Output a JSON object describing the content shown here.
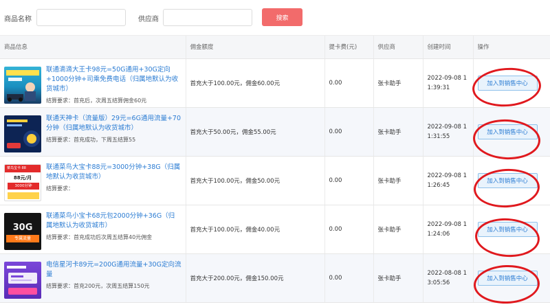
{
  "search": {
    "product_label": "商品名称",
    "product_value": "",
    "supplier_label": "供应商",
    "supplier_value": "",
    "button_label": "搜索"
  },
  "table": {
    "headers": [
      "商品信息",
      "佣金额度",
      "提卡费(元)",
      "供应商",
      "创建时间",
      "操作"
    ],
    "rows": [
      {
        "title": "联通滴滴大王卡98元=50G通用+30G定向+1000分钟+司乘免费电话（归属地默认为收货城市）",
        "settle": "结算要求：首充后，次周五结算佣金60元",
        "commission": "首充大于100.00元，佣金60.00元",
        "fee": "0.00",
        "supplier": "张卡助手",
        "created": "2022-09-08 11:39:31",
        "action": "加入到销售中心"
      },
      {
        "title": "联通天神卡（流量版）29元=6G通用流量+70分钟（归属地默认为收货城市）",
        "settle": "结算要求：首充成功，下周五结算55",
        "commission": "首充大于50.00元，佣金55.00元",
        "fee": "0.00",
        "supplier": "张卡助手",
        "created": "2022-09-08 11:31:55",
        "action": "加入到销售中心"
      },
      {
        "title": "联通菜鸟大宝卡88元=3000分钟+38G（归属地默认为收货城市）",
        "settle": "结算要求：",
        "commission": "首充大于100.00元，佣金50.00元",
        "fee": "0.00",
        "supplier": "张卡助手",
        "created": "2022-09-08 11:26:45",
        "action": "加入到销售中心",
        "thumb_text": [
          "菜鸟宝卡·88",
          "88元/月",
          "3000分钟"
        ]
      },
      {
        "title": "联通菜鸟小宝卡68元包2000分钟+36G（归属地默认为收货城市）",
        "settle": "结算要求：首充成功后次周五结算40元佣金",
        "commission": "首充大于100.00元，佣金40.00元",
        "fee": "0.00",
        "supplier": "张卡助手",
        "created": "2022-09-08 11:24:06",
        "action": "加入到销售中心",
        "thumb_text": [
          "30G",
          "专属流量"
        ]
      },
      {
        "title": "电信星河卡89元=200G通用流量+30G定向流量",
        "settle": "结算要求：首充200元，次周五结算150元",
        "commission": "首充大于200.00元，佣金150.00元",
        "fee": "0.00",
        "supplier": "张卡助手",
        "created": "2022-08-08 13:05:56",
        "action": "加入到销售中心"
      }
    ]
  },
  "colors": {
    "accent_red": "#f26b6b",
    "link_blue": "#2b7cd3",
    "annotation_red": "#e0191e"
  }
}
